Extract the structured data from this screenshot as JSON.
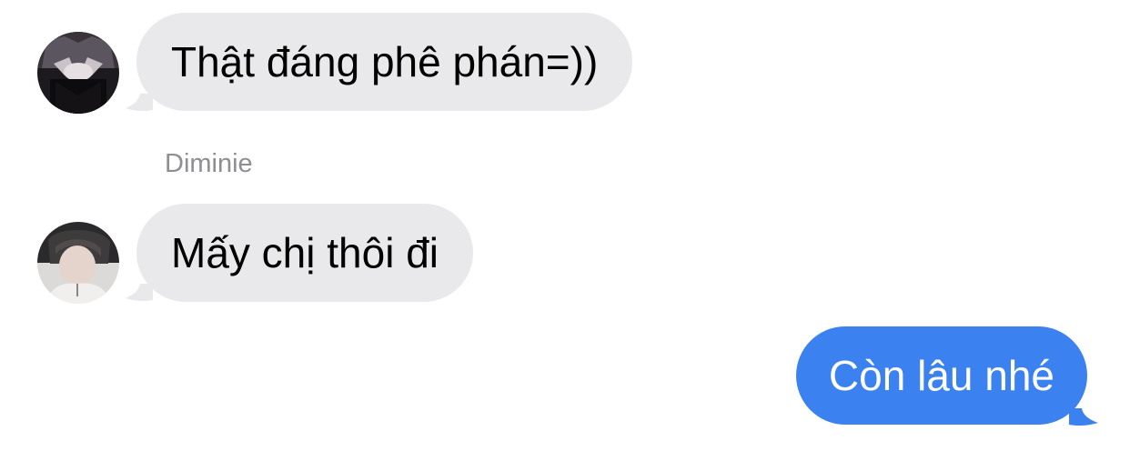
{
  "colors": {
    "incoming_bubble": "#e9e9eb",
    "outgoing_bubble": "#3b82f0",
    "incoming_text": "#000000",
    "outgoing_text": "#ffffff",
    "sender_name": "#8e8e93"
  },
  "messages": [
    {
      "direction": "incoming",
      "avatar_icon": "dark-photo-avatar",
      "text": "Thật đáng phê phán=))"
    },
    {
      "direction": "incoming",
      "sender_name": "Diminie",
      "avatar_icon": "person-photo-avatar",
      "text": "Mấy chị thôi đi"
    },
    {
      "direction": "outgoing",
      "text": "Còn lâu nhé"
    }
  ]
}
